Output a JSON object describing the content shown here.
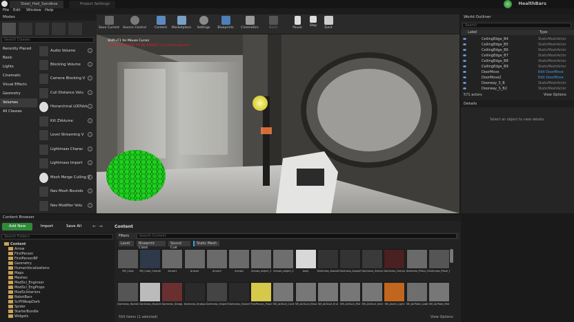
{
  "window": {
    "tabs": [
      "Steel_Hall_Sandbox",
      "Project Settings"
    ],
    "project_name": "HealthBars"
  },
  "menu": [
    "File",
    "Edit",
    "Window",
    "Help"
  ],
  "modes": {
    "title": "Modes",
    "search_placeholder": "Search Classes",
    "categories": [
      "Recently Placed",
      "Basic",
      "Lights",
      "Cinematic",
      "Visual Effects",
      "Geometry",
      "Volumes",
      "All Classes"
    ],
    "items": [
      "Audio Volume",
      "Blocking Volume",
      "Camera Blocking V",
      "Cull Distance Volu",
      "Hierarchical LODVolu",
      "Kill ZVolume",
      "Level Streaming V",
      "Lightmass Charac",
      "Lightmass Import",
      "Mesh Merge Culling V",
      "Nav Mesh Bounds",
      "Nav Modifier Volu"
    ]
  },
  "toolbar": [
    "Save Current",
    "Source Control",
    "Content",
    "Marketplace",
    "Settings",
    "Blueprints",
    "Cinematics",
    "Build",
    "Pause",
    "Stop",
    "Eject"
  ],
  "viewport": {
    "hint": "Shift+F1 for Mouse Cursor",
    "warning": "LIGHTING NEEDS TO BE REBUILT (3 unbuilt objects)"
  },
  "outliner": {
    "title": "World Outliner",
    "search_placeholder": "Search",
    "col_label": "Label",
    "col_type": "Type",
    "rows": [
      [
        "CeilingEdge_B4",
        "StaticMeshActor"
      ],
      [
        "CeilingEdge_B5",
        "StaticMeshActor"
      ],
      [
        "CeilingEdge_B6",
        "StaticMeshActor"
      ],
      [
        "CeilingEdge_B7",
        "StaticMeshActor"
      ],
      [
        "CeilingEdge_B8",
        "StaticMeshActor"
      ],
      [
        "CeilingEdge_B9",
        "StaticMeshActor"
      ],
      [
        "DoorMove",
        "Edit DoorMove"
      ],
      [
        "DoorMove2",
        "Edit DoorMove"
      ],
      [
        "Doorway_S_B",
        "StaticMeshActor"
      ],
      [
        "Doorway_S_B2",
        "StaticMeshActor"
      ]
    ],
    "count": "571 actors",
    "view_options": "View Options"
  },
  "details": {
    "title": "Details",
    "empty": "Select an object to view details."
  },
  "content_browser": {
    "title": "Content Browser",
    "add_new": "Add New",
    "import": "Import",
    "save_all": "Save All",
    "path": "Content",
    "search_folders": "Search Folders",
    "filters": "Filters",
    "search_content": "Search Content",
    "filter_tags": [
      "Level",
      "Blueprint Class",
      "Sound Cue",
      "Static Mesh"
    ],
    "tree_root": "Content",
    "tree": [
      "Arrow",
      "FirstPerson",
      "FirstPersonBP",
      "Geometry",
      "HumanVocalizations",
      "Maps",
      "Meshes",
      "ModSci_Engineer",
      "ModSci_EngProps",
      "ModScInteriors",
      "RobotBars",
      "SciFiWeapDark",
      "Spider",
      "StarterBundle",
      "Widgets"
    ],
    "assets_row1": [
      "SM_Cube",
      "SM_Cube_Chamfer",
      "Arrow1",
      "Arrow2",
      "Arrow3",
      "Arrow4",
      "Arrows_object_1",
      "Arrows_object_2",
      "body",
      "Darkness_AssaultRifle_Ammo",
      "Darkness_AssaultRifle_Pickup",
      "Darkness_Grenade_Launcher",
      "Darkness_Grenade_Launcher",
      "Darkness_Pistol_Ammo",
      "Darkness_Pistol_Pickup"
    ],
    "assets_row2": [
      "Darkness_Rocket",
      "Darkness_Rocket",
      "Darkness_Shotgun_Ammo",
      "Darkness_Shotgun_Pickup",
      "Darkness_SniperRifle_Ammo",
      "Darkness_SniperRifle_Pickup",
      "FirstPerson_ProjectileMesh",
      "SM_AirDuct_Cord",
      "SM_AirDuct_Elbow",
      "SM_AirDuct_End",
      "SM_AirDuct_Mid",
      "SM_AirDuct_Vent",
      "SM_Alarm_Light",
      "SM_AirPlate_Ladder",
      "SM_AirPlate_Mid"
    ],
    "status": "550 items (1 selected)",
    "view_options": "View Options"
  }
}
